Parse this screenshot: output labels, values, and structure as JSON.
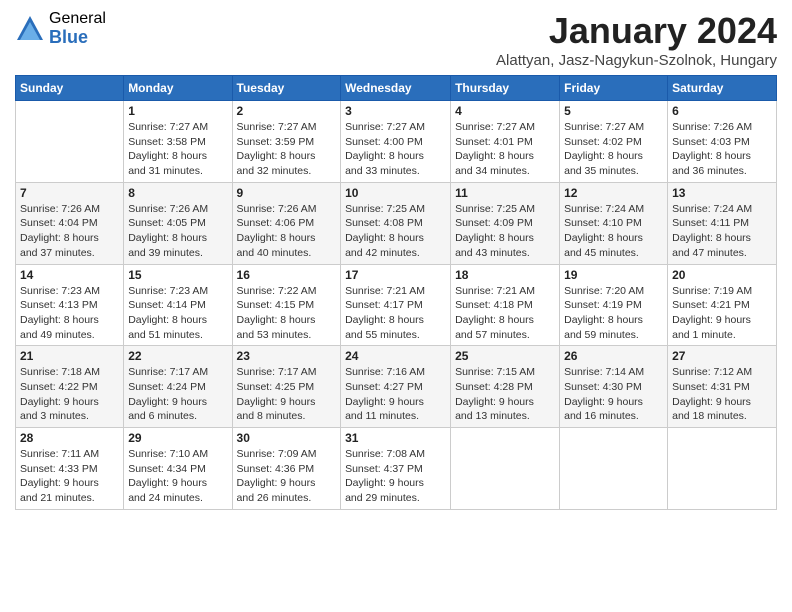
{
  "header": {
    "logo_general": "General",
    "logo_blue": "Blue",
    "month_title": "January 2024",
    "location": "Alattyan, Jasz-Nagykun-Szolnok, Hungary"
  },
  "days_of_week": [
    "Sunday",
    "Monday",
    "Tuesday",
    "Wednesday",
    "Thursday",
    "Friday",
    "Saturday"
  ],
  "weeks": [
    [
      {
        "day": "",
        "info": ""
      },
      {
        "day": "1",
        "info": "Sunrise: 7:27 AM\nSunset: 3:58 PM\nDaylight: 8 hours\nand 31 minutes."
      },
      {
        "day": "2",
        "info": "Sunrise: 7:27 AM\nSunset: 3:59 PM\nDaylight: 8 hours\nand 32 minutes."
      },
      {
        "day": "3",
        "info": "Sunrise: 7:27 AM\nSunset: 4:00 PM\nDaylight: 8 hours\nand 33 minutes."
      },
      {
        "day": "4",
        "info": "Sunrise: 7:27 AM\nSunset: 4:01 PM\nDaylight: 8 hours\nand 34 minutes."
      },
      {
        "day": "5",
        "info": "Sunrise: 7:27 AM\nSunset: 4:02 PM\nDaylight: 8 hours\nand 35 minutes."
      },
      {
        "day": "6",
        "info": "Sunrise: 7:26 AM\nSunset: 4:03 PM\nDaylight: 8 hours\nand 36 minutes."
      }
    ],
    [
      {
        "day": "7",
        "info": "Sunrise: 7:26 AM\nSunset: 4:04 PM\nDaylight: 8 hours\nand 37 minutes."
      },
      {
        "day": "8",
        "info": "Sunrise: 7:26 AM\nSunset: 4:05 PM\nDaylight: 8 hours\nand 39 minutes."
      },
      {
        "day": "9",
        "info": "Sunrise: 7:26 AM\nSunset: 4:06 PM\nDaylight: 8 hours\nand 40 minutes."
      },
      {
        "day": "10",
        "info": "Sunrise: 7:25 AM\nSunset: 4:08 PM\nDaylight: 8 hours\nand 42 minutes."
      },
      {
        "day": "11",
        "info": "Sunrise: 7:25 AM\nSunset: 4:09 PM\nDaylight: 8 hours\nand 43 minutes."
      },
      {
        "day": "12",
        "info": "Sunrise: 7:24 AM\nSunset: 4:10 PM\nDaylight: 8 hours\nand 45 minutes."
      },
      {
        "day": "13",
        "info": "Sunrise: 7:24 AM\nSunset: 4:11 PM\nDaylight: 8 hours\nand 47 minutes."
      }
    ],
    [
      {
        "day": "14",
        "info": "Sunrise: 7:23 AM\nSunset: 4:13 PM\nDaylight: 8 hours\nand 49 minutes."
      },
      {
        "day": "15",
        "info": "Sunrise: 7:23 AM\nSunset: 4:14 PM\nDaylight: 8 hours\nand 51 minutes."
      },
      {
        "day": "16",
        "info": "Sunrise: 7:22 AM\nSunset: 4:15 PM\nDaylight: 8 hours\nand 53 minutes."
      },
      {
        "day": "17",
        "info": "Sunrise: 7:21 AM\nSunset: 4:17 PM\nDaylight: 8 hours\nand 55 minutes."
      },
      {
        "day": "18",
        "info": "Sunrise: 7:21 AM\nSunset: 4:18 PM\nDaylight: 8 hours\nand 57 minutes."
      },
      {
        "day": "19",
        "info": "Sunrise: 7:20 AM\nSunset: 4:19 PM\nDaylight: 8 hours\nand 59 minutes."
      },
      {
        "day": "20",
        "info": "Sunrise: 7:19 AM\nSunset: 4:21 PM\nDaylight: 9 hours\nand 1 minute."
      }
    ],
    [
      {
        "day": "21",
        "info": "Sunrise: 7:18 AM\nSunset: 4:22 PM\nDaylight: 9 hours\nand 3 minutes."
      },
      {
        "day": "22",
        "info": "Sunrise: 7:17 AM\nSunset: 4:24 PM\nDaylight: 9 hours\nand 6 minutes."
      },
      {
        "day": "23",
        "info": "Sunrise: 7:17 AM\nSunset: 4:25 PM\nDaylight: 9 hours\nand 8 minutes."
      },
      {
        "day": "24",
        "info": "Sunrise: 7:16 AM\nSunset: 4:27 PM\nDaylight: 9 hours\nand 11 minutes."
      },
      {
        "day": "25",
        "info": "Sunrise: 7:15 AM\nSunset: 4:28 PM\nDaylight: 9 hours\nand 13 minutes."
      },
      {
        "day": "26",
        "info": "Sunrise: 7:14 AM\nSunset: 4:30 PM\nDaylight: 9 hours\nand 16 minutes."
      },
      {
        "day": "27",
        "info": "Sunrise: 7:12 AM\nSunset: 4:31 PM\nDaylight: 9 hours\nand 18 minutes."
      }
    ],
    [
      {
        "day": "28",
        "info": "Sunrise: 7:11 AM\nSunset: 4:33 PM\nDaylight: 9 hours\nand 21 minutes."
      },
      {
        "day": "29",
        "info": "Sunrise: 7:10 AM\nSunset: 4:34 PM\nDaylight: 9 hours\nand 24 minutes."
      },
      {
        "day": "30",
        "info": "Sunrise: 7:09 AM\nSunset: 4:36 PM\nDaylight: 9 hours\nand 26 minutes."
      },
      {
        "day": "31",
        "info": "Sunrise: 7:08 AM\nSunset: 4:37 PM\nDaylight: 9 hours\nand 29 minutes."
      },
      {
        "day": "",
        "info": ""
      },
      {
        "day": "",
        "info": ""
      },
      {
        "day": "",
        "info": ""
      }
    ]
  ]
}
